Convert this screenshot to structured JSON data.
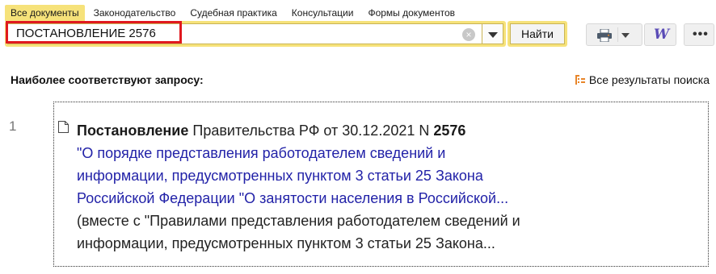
{
  "tabs": [
    {
      "label": "Все документы",
      "active": true
    },
    {
      "label": "Законодательство",
      "active": false
    },
    {
      "label": "Судебная практика",
      "active": false
    },
    {
      "label": "Консультации",
      "active": false
    },
    {
      "label": "Формы документов",
      "active": false
    }
  ],
  "search": {
    "query": "ПОСТАНОВЛЕНИЕ 2576",
    "clear_glyph": "×",
    "find_label": "Найти"
  },
  "toolbar": {
    "print_icon": "printer-icon",
    "word_icon": "word-export-icon",
    "word_glyph": "W",
    "more_icon": "more-icon",
    "more_glyph": "•••"
  },
  "results": {
    "heading": "Наиболее соответствуют запросу:",
    "all_results_label": "Все результаты поиска",
    "items": [
      {
        "number": "1",
        "doc_type": "Постановление",
        "issuer_date": " Правительства РФ от 30.12.2021 N ",
        "doc_number": "2576",
        "link_lines": [
          "\"О порядке представления работодателем сведений и",
          "информации, предусмотренных пунктом 3 статьи 25 Закона",
          "Российской Федерации \"О занятости населения в Российской..."
        ],
        "note_lines": [
          "(вместе с \"Правилами представления работодателем сведений и",
          "информации, предусмотренных пунктом 3 статьи 25 Закона..."
        ]
      }
    ]
  },
  "colors": {
    "accent_yellow": "#f6e27a",
    "link_blue": "#2222a8",
    "highlight_red": "#e0191e",
    "icon_orange": "#e8862a",
    "word_purple": "#5a4bb6"
  }
}
